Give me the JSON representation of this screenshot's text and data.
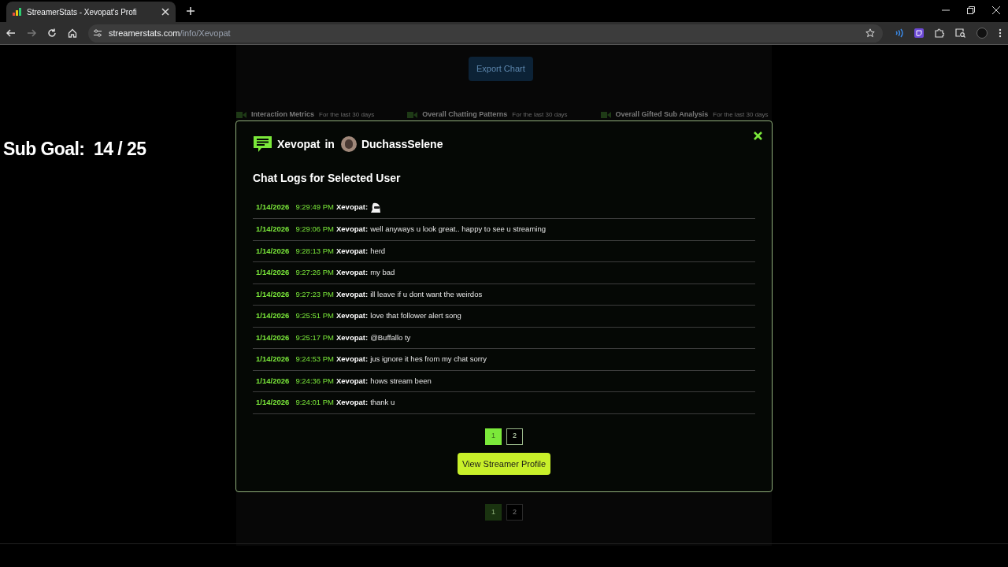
{
  "browser": {
    "tab_title": "StreamerStats - Xevopat's Profi",
    "url_domain": "streamerstats.com",
    "url_path": "/info/Xevopat"
  },
  "overlay": {
    "sub_goal": "Sub Goal:  14 / 25"
  },
  "background": {
    "export_button": "Export Chart",
    "sections": [
      {
        "title": "Interaction Metrics",
        "subtitle": "For the last 30 days"
      },
      {
        "title": "Overall Chatting Patterns",
        "subtitle": "For the last 30 days"
      },
      {
        "title": "Overall Gifted Sub Analysis",
        "subtitle": "For the last 30 days"
      }
    ],
    "pagination": [
      {
        "label": "1",
        "selected": true
      },
      {
        "label": "2",
        "selected": false
      }
    ]
  },
  "modal": {
    "user": "Xevopat",
    "connector": "in",
    "streamer": "DuchassSelene",
    "heading": "Chat Logs for Selected User",
    "messages": [
      {
        "date": "1/14/2026",
        "time": "9:29:49 PM",
        "user": "Xevopat:",
        "kind": "emote"
      },
      {
        "date": "1/14/2026",
        "time": "9:29:06 PM",
        "user": "Xevopat:",
        "kind": "text",
        "text": "well anyways u look great.. happy to see u streaming"
      },
      {
        "date": "1/14/2026",
        "time": "9:28:13 PM",
        "user": "Xevopat:",
        "kind": "text",
        "text": "herd"
      },
      {
        "date": "1/14/2026",
        "time": "9:27:26 PM",
        "user": "Xevopat:",
        "kind": "text",
        "text": "my bad"
      },
      {
        "date": "1/14/2026",
        "time": "9:27:23 PM",
        "user": "Xevopat:",
        "kind": "text",
        "text": "ill leave if u dont want the weirdos"
      },
      {
        "date": "1/14/2026",
        "time": "9:25:51 PM",
        "user": "Xevopat:",
        "kind": "text",
        "text": "love that follower alert song"
      },
      {
        "date": "1/14/2026",
        "time": "9:25:17 PM",
        "user": "Xevopat:",
        "kind": "text",
        "text": "@Buffallo ty"
      },
      {
        "date": "1/14/2026",
        "time": "9:24:53 PM",
        "user": "Xevopat:",
        "kind": "text",
        "text": "jus ignore it hes from my chat sorry"
      },
      {
        "date": "1/14/2026",
        "time": "9:24:36 PM",
        "user": "Xevopat:",
        "kind": "text",
        "text": "hows stream been"
      },
      {
        "date": "1/14/2026",
        "time": "9:24:01 PM",
        "user": "Xevopat:",
        "kind": "text",
        "text": "thank u"
      }
    ],
    "pagination": [
      {
        "label": "1",
        "selected": true
      },
      {
        "label": "2",
        "selected": false
      }
    ],
    "profile_button": "View Streamer Profile"
  }
}
